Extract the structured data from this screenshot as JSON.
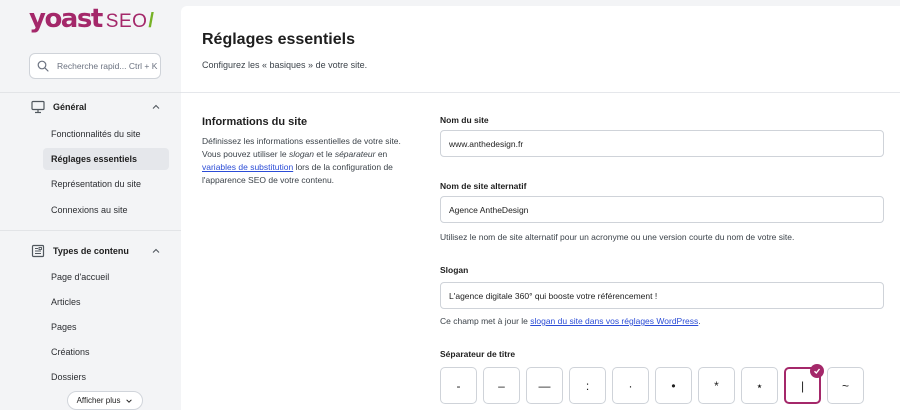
{
  "logo": {
    "word": "yoast",
    "seo": "SEO",
    "slash": "/"
  },
  "search": {
    "placeholder": "Recherche rapid... Ctrl + K"
  },
  "sidebar": {
    "general": {
      "label": "Général",
      "items": [
        {
          "label": "Fonctionnalités du site"
        },
        {
          "label": "Réglages essentiels"
        },
        {
          "label": "Représentation du site"
        },
        {
          "label": "Connexions au site"
        }
      ]
    },
    "content_types": {
      "label": "Types de contenu",
      "items": [
        {
          "label": "Page d'accueil"
        },
        {
          "label": "Articles"
        },
        {
          "label": "Pages"
        },
        {
          "label": "Créations"
        },
        {
          "label": "Dossiers"
        }
      ]
    },
    "show_more": "Afficher plus"
  },
  "page": {
    "title": "Réglages essentiels",
    "subtitle": "Configurez les « basiques » de votre site."
  },
  "section": {
    "title": "Informations du site",
    "desc_1": "Définissez les informations essentielles de votre site. Vous pouvez utiliser le ",
    "desc_slogan": "slogan",
    "desc_2": " et le ",
    "desc_sep": "séparateur",
    "desc_3": " en ",
    "desc_link": "variables de substitution",
    "desc_4": " lors de la configuration de l'apparence SEO de votre contenu."
  },
  "fields": {
    "site_name": {
      "label": "Nom du site",
      "value": "www.anthedesign.fr"
    },
    "alt_name": {
      "label": "Nom de site alternatif",
      "value": "Agence AntheDesign",
      "help": "Utilisez le nom de site alternatif pour un acronyme ou une version courte du nom de votre site."
    },
    "slogan": {
      "label": "Slogan",
      "value": "L'agence digitale 360° qui booste votre référencement !",
      "help_prefix": "Ce champ met à jour le ",
      "help_link": "slogan du site dans vos réglages WordPress",
      "help_suffix": "."
    },
    "separator": {
      "label": "Séparateur de titre",
      "options": [
        "-",
        "–",
        "—",
        ":",
        "·",
        "•",
        "*",
        "⋆",
        "|",
        "~"
      ],
      "selected_index": 8
    }
  },
  "colors": {
    "brand": "#a4286a",
    "accent_green": "#77b227",
    "link": "#2b4cd6"
  }
}
